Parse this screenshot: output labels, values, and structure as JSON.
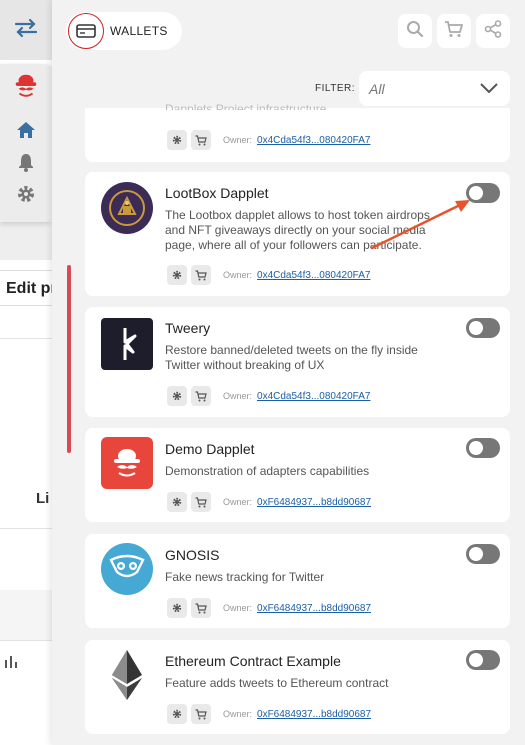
{
  "header": {
    "wallets_label": "WALLETS",
    "filter_label": "FILTER:",
    "filter_value": "All"
  },
  "top_buttons": [
    "search-icon",
    "cart-icon",
    "share-icon"
  ],
  "host_page": {
    "edit_label": "Edit pr",
    "li_text": "Li"
  },
  "cards": [
    {
      "title": "",
      "description": "Dapplets Project infrastructure",
      "owner_label": "Owner:",
      "owner": "0x4Cda54f3...080420FA7"
    },
    {
      "title": "LootBox Dapplet",
      "description": "The Lootbox dapplet allows to host token airdrops and NFT giveaways directly on your social media page, where all of your followers can participate.",
      "owner_label": "Owner:",
      "owner": "0x4Cda54f3...080420FA7"
    },
    {
      "title": "Tweery",
      "description": "Restore banned/deleted tweets on the fly inside Twitter without breaking of UX",
      "owner_label": "Owner:",
      "owner": "0x4Cda54f3...080420FA7"
    },
    {
      "title": "Demo Dapplet",
      "description": "Demonstration of adapters capabilities",
      "owner_label": "Owner:",
      "owner": "0xF6484937...b8dd90687"
    },
    {
      "title": "GNOSIS",
      "description": "Fake news tracking for Twitter",
      "owner_label": "Owner:",
      "owner": "0xF6484937...b8dd90687"
    },
    {
      "title": "Ethereum Contract Example",
      "description": "Feature adds tweets to Ethereum contract",
      "owner_label": "Owner:",
      "owner": "0xF6484937...b8dd90687"
    }
  ],
  "colors": {
    "accent": "#d94a58",
    "link": "#1a5fa8",
    "toggle_off": "#777777",
    "arrow": "#e8532b"
  }
}
